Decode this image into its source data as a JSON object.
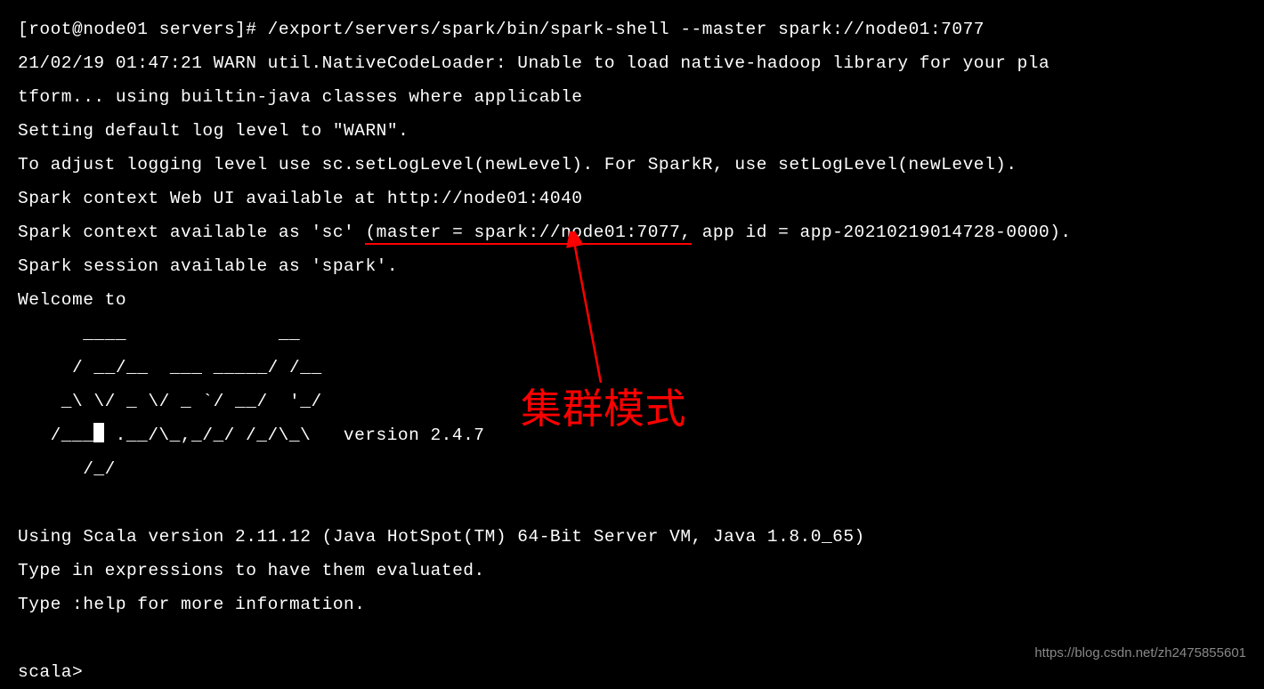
{
  "terminal": {
    "prompt": "[root@node01 servers]# ",
    "command": "/export/servers/spark/bin/spark-shell --master spark://node01:7077",
    "output": {
      "line1": "21/02/19 01:47:21 WARN util.NativeCodeLoader: Unable to load native-hadoop library for your pla",
      "line2": "tform... using builtin-java classes where applicable",
      "line3": "Setting default log level to \"WARN\".",
      "line4": "To adjust logging level use sc.setLogLevel(newLevel). For SparkR, use setLogLevel(newLevel).",
      "line5": "Spark context Web UI available at http://node01:4040",
      "line6_pre": "Spark context available as 'sc' ",
      "line6_underlined": "(master = spark://node01:7077,",
      "line6_post": " app id = app-20210219014728-0000).",
      "line7": "Spark session available as 'spark'.",
      "line8": "Welcome to",
      "ascii1": "      ____              __",
      "ascii2": "     / __/__  ___ _____/ /__",
      "ascii3": "    _\\ \\/ _ \\/ _ `/ __/  '_/",
      "ascii4_pre": "   /___",
      "ascii4_post": " .__/\\_,_/_/ /_/\\_\\   version 2.4.7",
      "ascii5": "      /_/",
      "line9": "Using Scala version 2.11.12 (Java HotSpot(TM) 64-Bit Server VM, Java 1.8.0_65)",
      "line10": "Type in expressions to have them evaluated.",
      "line11": "Type :help for more information.",
      "prompt2": "scala> "
    }
  },
  "annotation": {
    "label": "集群模式"
  },
  "watermark": {
    "text": "https://blog.csdn.net/zh2475855601"
  }
}
